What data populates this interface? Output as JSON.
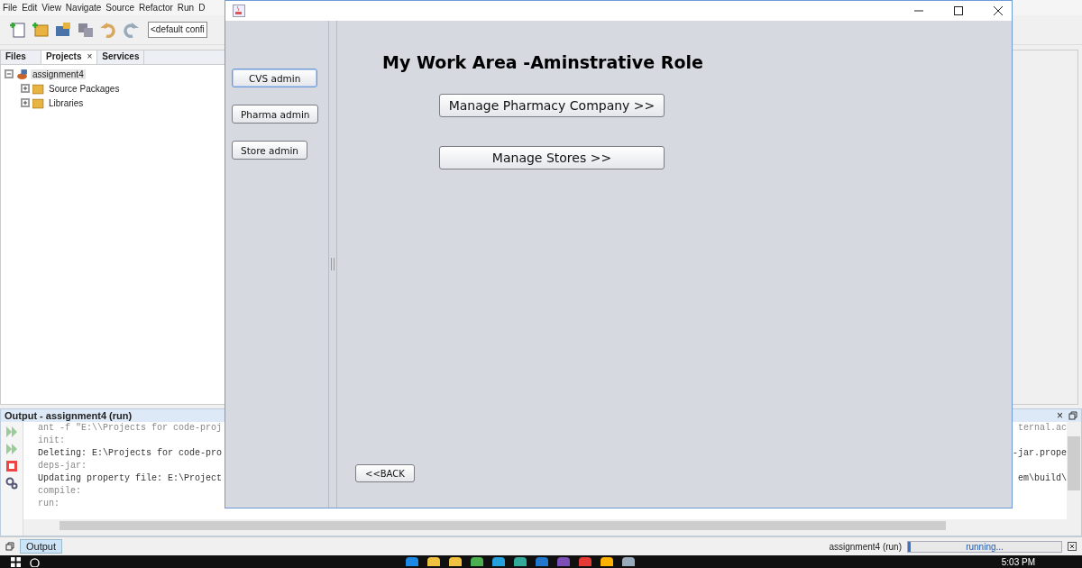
{
  "ide": {
    "menu": [
      "File",
      "Edit",
      "View",
      "Navigate",
      "Source",
      "Refactor",
      "Run",
      "D"
    ],
    "config_field": {
      "value": "<default confi"
    },
    "tabs": [
      {
        "label": "Files",
        "selected": false,
        "closable": false
      },
      {
        "label": "Projects",
        "selected": true,
        "closable": true
      },
      {
        "label": "Services",
        "selected": false,
        "closable": false
      }
    ],
    "close_glyph": "×",
    "tree": [
      {
        "label": "assignment4",
        "expanded": true,
        "selected": true,
        "children": [
          {
            "label": "Source Packages",
            "expanded": false,
            "selected": false
          },
          {
            "label": "Libraries",
            "expanded": false,
            "selected": false
          }
        ]
      }
    ],
    "output": {
      "title": "Output - assignment4 (run)",
      "lines": [
        {
          "text": "ant -f \"E:\\\\Projects for code-proj",
          "tail": "ternal.ac",
          "kind": "dim"
        },
        {
          "text": "init:",
          "kind": "dim"
        },
        {
          "text": "Deleting: E:\\Projects for code-pro",
          "tail": "-jar.prope",
          "kind": "normal"
        },
        {
          "text": "deps-jar:",
          "kind": "dim"
        },
        {
          "text": "Updating property file: E:\\Project",
          "tail": "em\\build\\",
          "kind": "normal"
        },
        {
          "text": "compile:",
          "kind": "dim"
        },
        {
          "text": "run:",
          "kind": "dim"
        }
      ]
    },
    "status_bar": {
      "output_tab": "Output",
      "task": "assignment4 (run)",
      "progress_text": "running...",
      "level": 0.02
    },
    "taskbar": {
      "time": "5:03 PM"
    }
  },
  "app_window": {
    "nav_buttons": [
      {
        "label": "CVS admin",
        "selected": true
      },
      {
        "label": "Pharma admin",
        "selected": false
      },
      {
        "label": "Store admin",
        "selected": false
      }
    ],
    "heading": "My Work Area -Aminstrative Role",
    "actions": [
      "Manage Pharmacy Company >>",
      "Manage Stores >>"
    ],
    "back_button": "<<BACK"
  }
}
